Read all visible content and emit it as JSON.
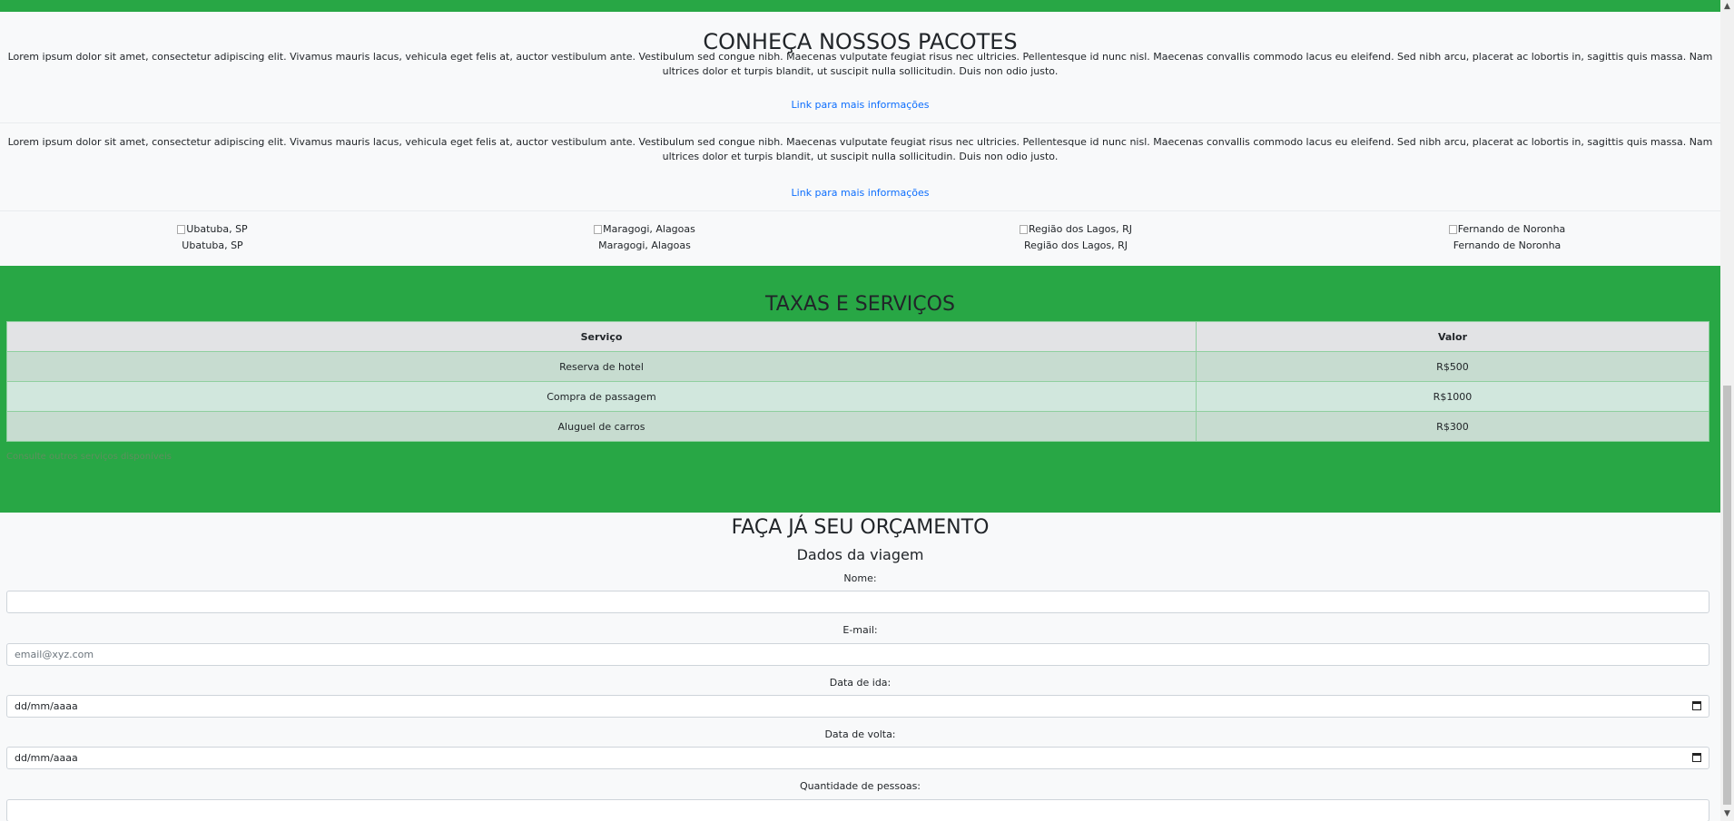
{
  "packages": {
    "title": "CONHEÇA NOSSOS PACOTES",
    "items": [
      {
        "text": "Lorem ipsum dolor sit amet, consectetur adipiscing elit. Vivamus mauris lacus, vehicula eget felis at, auctor vestibulum ante. Vestibulum sed congue nibh. Maecenas vulputate feugiat risus nec ultricies. Pellentesque id nunc nisl. Maecenas convallis commodo lacus eu eleifend. Sed nibh arcu, placerat ac lobortis in, sagittis quis massa. Nam ultrices dolor et turpis blandit, ut suscipit nulla sollicitudin. Duis non odio justo.",
        "link": "Link para mais informações"
      },
      {
        "text": "Lorem ipsum dolor sit amet, consectetur adipiscing elit. Vivamus mauris lacus, vehicula eget felis at, auctor vestibulum ante. Vestibulum sed congue nibh. Maecenas vulputate feugiat risus nec ultricies. Pellentesque id nunc nisl. Maecenas convallis commodo lacus eu eleifend. Sed nibh arcu, placerat ac lobortis in, sagittis quis massa. Nam ultrices dolor et turpis blandit, ut suscipit nulla sollicitudin. Duis non odio justo.",
        "link": "Link para mais informações"
      }
    ],
    "destinations": [
      {
        "alt": "Ubatuba, SP",
        "caption": "Ubatuba, SP"
      },
      {
        "alt": "Maragogi, Alagoas",
        "caption": "Maragogi, Alagoas"
      },
      {
        "alt": "Região dos Lagos, RJ",
        "caption": "Região dos Lagos, RJ"
      },
      {
        "alt": "Fernando de Noronha",
        "caption": "Fernando de Noronha"
      }
    ]
  },
  "fees": {
    "title": "TAXAS E SERVIÇOS",
    "headers": [
      "Serviço",
      "Valor"
    ],
    "rows": [
      [
        "Reserva de hotel",
        "R$500"
      ],
      [
        "Compra de passagem",
        "R$1000"
      ],
      [
        "Aluguel de carros",
        "R$300"
      ]
    ],
    "caption": "Consulte outros serviços disponíveis"
  },
  "quote": {
    "title": "FAÇA JÁ SEU ORÇAMENTO",
    "subtitle": "Dados da viagem",
    "fields": {
      "name": {
        "label": "Nome:",
        "value": ""
      },
      "email": {
        "label": "E-mail:",
        "placeholder": "email@xyz.com"
      },
      "departure": {
        "label": "Data de ida:",
        "value": "dd/mm/aaaa"
      },
      "return": {
        "label": "Data de volta:",
        "value": "dd/mm/aaaa"
      },
      "people": {
        "label": "Quantidade de pessoas:",
        "value": ""
      }
    }
  },
  "colors": {
    "page_green": "#28a745",
    "section_bg": "#f8f9fa",
    "link_blue": "#0d6efd",
    "table_header": "#e2e3e5",
    "table_row_odd": "#c7dcd0",
    "table_row_even": "#d1e7dd"
  }
}
